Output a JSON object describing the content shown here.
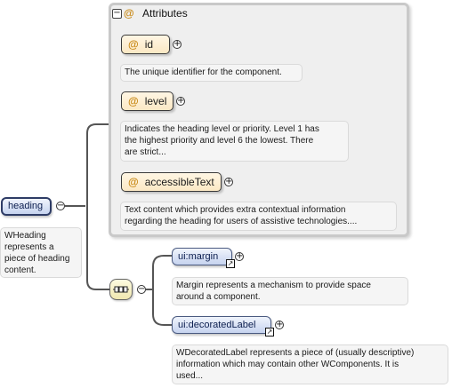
{
  "root": {
    "name": "heading",
    "doc": [
      "WHeading",
      "represents a",
      "piece of heading",
      "content."
    ]
  },
  "attributes_group": {
    "title": "Attributes",
    "items": [
      {
        "name": "id",
        "doc": [
          "The unique identifier for the component."
        ]
      },
      {
        "name": "level",
        "doc": [
          "Indicates the heading level or priority. Level 1 has",
          "the highest priority and level 6 the lowest. There",
          "are strict..."
        ]
      },
      {
        "name": "accessibleText",
        "doc": [
          "Text content which provides extra contextual information",
          "regarding the heading for users of assistive technologies...."
        ]
      }
    ]
  },
  "sequence": {
    "children": [
      {
        "name": "ui:margin",
        "doc": [
          "Margin represents a mechanism to provide space",
          "around a component."
        ]
      },
      {
        "name": "ui:decoratedLabel",
        "doc": [
          "WDecoratedLabel represents a piece of (usually descriptive)",
          "information which may contain other WComponents. It is",
          "used..."
        ]
      }
    ]
  },
  "icons": {
    "collapse": "minus-circle-icon",
    "expand": "plus-circle-icon",
    "reference": "link-arrow-icon",
    "sequence": "sequence-compositor-icon"
  },
  "colors": {
    "attribute_fill": "#fbe8c4",
    "element_fill": "#c6d3ef",
    "at_sign": "#c98a18",
    "panel": "#efefef"
  }
}
